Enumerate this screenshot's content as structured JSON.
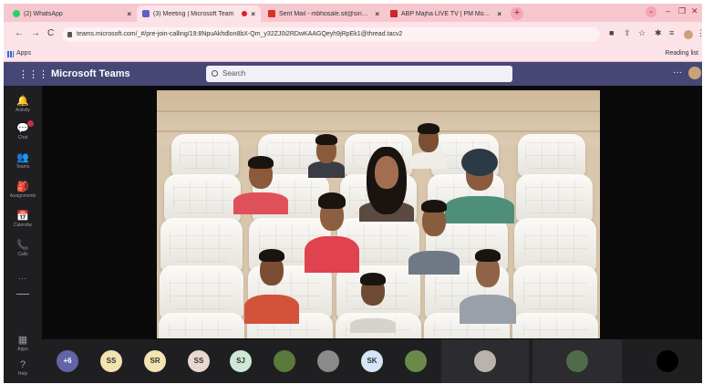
{
  "browser": {
    "tabs": [
      {
        "title": "(2) WhatsApp",
        "favicon_color": "#25d366"
      },
      {
        "title": "(3) Meeting | Microsoft Team",
        "favicon_color": "#5b5fc7",
        "active": true,
        "recording": true
      },
      {
        "title": "Sent Mail - mbhosale.sit@sinhgad",
        "favicon_color": "#d93025"
      },
      {
        "title": "ABP Majha LIVE TV | PM Modi Li",
        "favicon_color": "#c62828"
      }
    ],
    "close_glyph": "×",
    "new_tab_glyph": "+",
    "url": "teams.microsoft.com/_#/pre-join-calling/19:8NpuAkhdlon8bX-Qm_y32ZJ0i2RDwKAAGQeyh9jRpEk1@thread.tacv2",
    "bookmarks": {
      "apps": "Apps",
      "reading_list": "Reading list"
    }
  },
  "teams": {
    "title": "Microsoft Teams",
    "search_placeholder": "Search",
    "more_glyph": "···",
    "rail": [
      {
        "label": "Activity",
        "icon": "bell-icon",
        "glyph": "🔔"
      },
      {
        "label": "Chat",
        "icon": "chat-icon",
        "glyph": "💬",
        "badge": true
      },
      {
        "label": "Teams",
        "icon": "teams-icon",
        "glyph": "👥"
      },
      {
        "label": "Assignments",
        "icon": "assignments-icon",
        "glyph": "🎒"
      },
      {
        "label": "Calendar",
        "icon": "calendar-icon",
        "glyph": "📅"
      },
      {
        "label": "Calls",
        "icon": "calls-icon",
        "glyph": "📞"
      }
    ],
    "rail_bottom": [
      {
        "label": "Apps",
        "icon": "apps-icon",
        "glyph": "▦"
      },
      {
        "label": "Help",
        "icon": "help-icon",
        "glyph": "?"
      }
    ]
  },
  "gallery": {
    "participants": [
      {
        "label": "+6",
        "color": "#6264a7",
        "text_color": "#ffffff"
      },
      {
        "label": "SS",
        "color": "#f4e3b2"
      },
      {
        "label": "SR",
        "color": "#f4e3b2"
      },
      {
        "label": "SS",
        "color": "#e8d8d2"
      },
      {
        "label": "SJ",
        "color": "#cfe8d4"
      },
      {
        "label": "",
        "color": "#5a7a3c"
      },
      {
        "label": "",
        "color": "#8a8a8a"
      },
      {
        "label": "SK",
        "color": "#d6e6f7"
      },
      {
        "label": "",
        "color": "#6a8a4a"
      }
    ]
  }
}
